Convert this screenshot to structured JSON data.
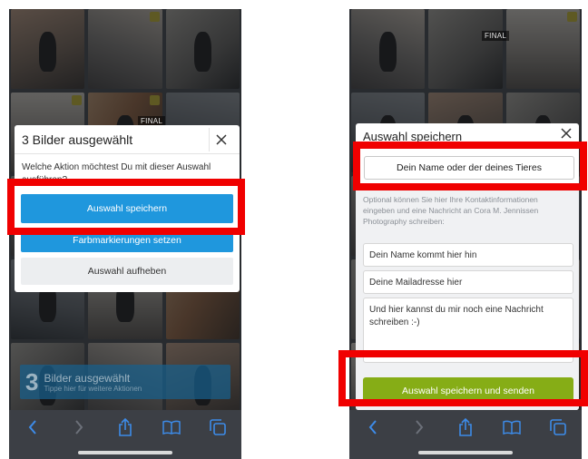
{
  "left": {
    "final_label": "FINAL",
    "dialog": {
      "title": "3 Bilder ausgewählt",
      "question": "Welche Aktion möchtest Du mit dieser Auswahl ausführen?",
      "buttons": {
        "save": "Auswahl speichern",
        "color": "Farbmarkierungen setzen",
        "clear": "Auswahl aufheben"
      }
    },
    "banner": {
      "count": "3",
      "title": "Bilder ausgewählt",
      "subtitle": "Tippe hier für weitere Aktionen"
    }
  },
  "right": {
    "final_label": "FINAL",
    "dialog": {
      "title": "Auswahl speichern",
      "name_box": "Dein Name oder der deines Tieres",
      "optional_text": "Optional können Sie hier Ihre Kontaktinformationen eingeben und eine Nachricht an Cora M. Jennissen Photography schreiben:",
      "name_placeholder": "Dein Name kommt hier hin",
      "mail_placeholder": "Deine Mailadresse hier",
      "message_placeholder": "Und hier kannst du mir noch eine Nachricht schreiben :-)",
      "submit": "Auswahl speichern und senden"
    }
  },
  "toolbar_icons": [
    "back-icon",
    "forward-icon",
    "share-icon",
    "bookmarks-icon",
    "tabs-icon"
  ],
  "colors": {
    "primary_blue": "#1f97dd",
    "submit_green": "#86ad16",
    "highlight_red": "#f00000",
    "toolbar_icon_blue": "#3d8be8"
  }
}
